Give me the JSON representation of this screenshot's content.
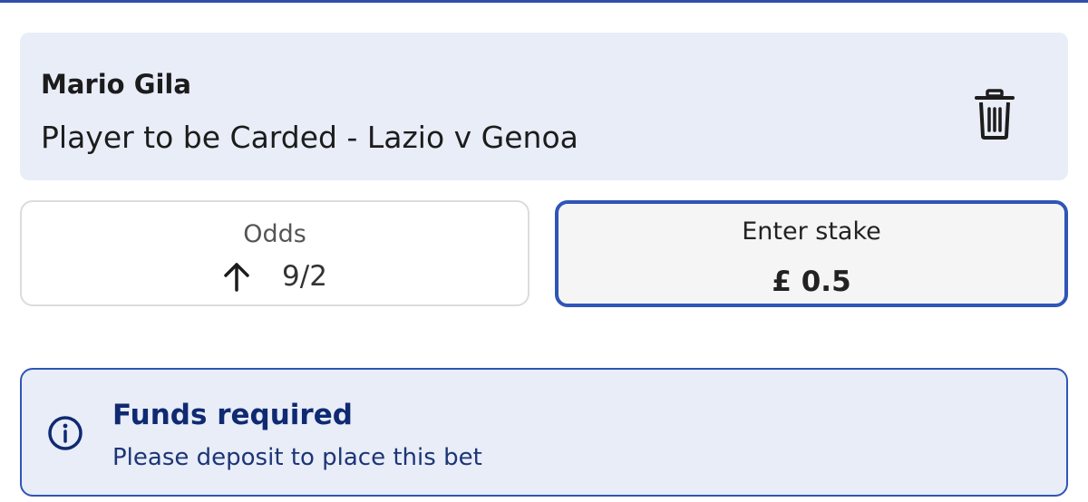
{
  "selection": {
    "player_name": "Mario Gila",
    "market": "Player to be Carded - Lazio v Genoa",
    "delete_icon": "trash-icon"
  },
  "odds": {
    "label": "Odds",
    "value": "9/2",
    "trend_icon": "arrow-up-icon"
  },
  "stake": {
    "label": "Enter stake",
    "value": "£ 0.5"
  },
  "alert": {
    "icon": "info-icon",
    "title": "Funds required",
    "message": "Please deposit to place this bet"
  },
  "colors": {
    "accent": "#2f55b8",
    "card_background": "#e8edf7",
    "alert_title": "#0f2a72"
  }
}
